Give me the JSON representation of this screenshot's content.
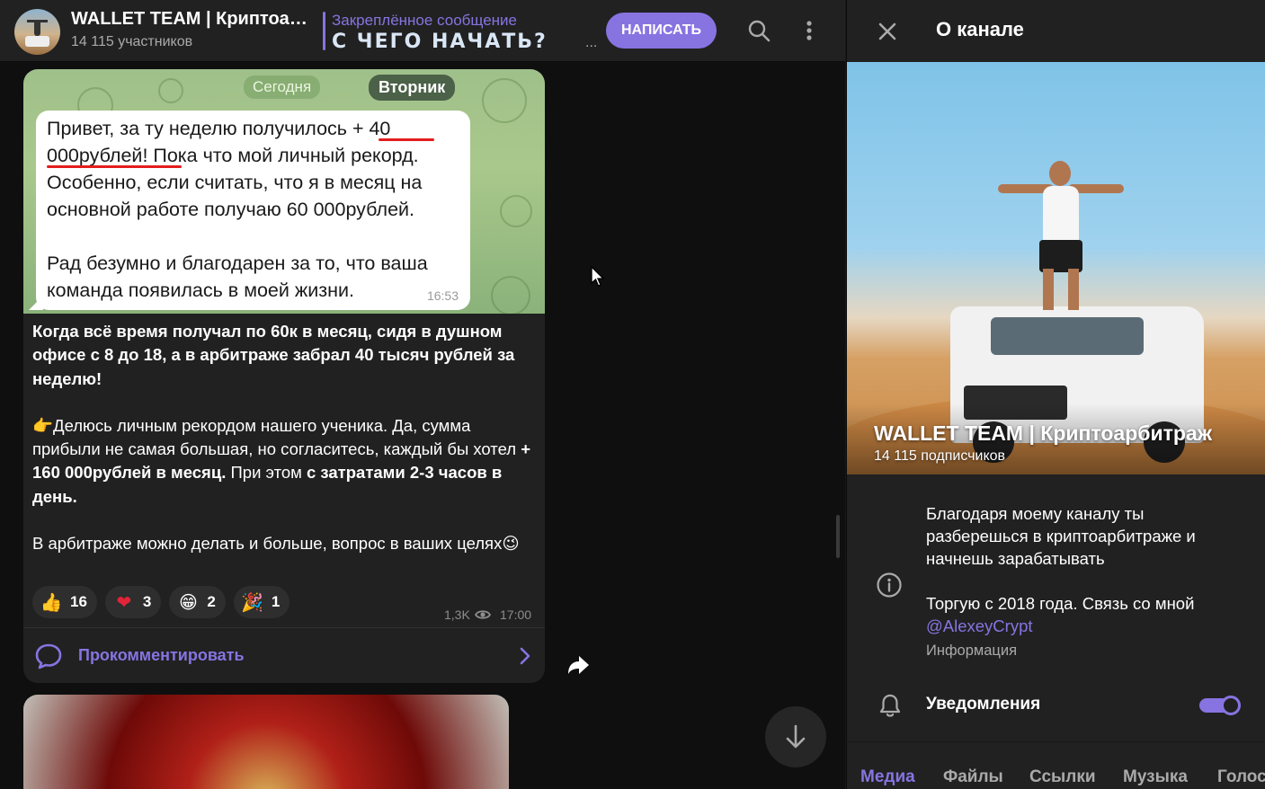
{
  "chat": {
    "title": "WALLET TEAM | Криптоарбитраж",
    "subtitle": "14 115 участников",
    "pinned_label": "Закреплённое сообщение",
    "pinned_text": "С ЧЕГО НАЧАТЬ?",
    "pinned_ellipsis": "...",
    "write_button": "НАПИСАТЬ"
  },
  "message": {
    "image": {
      "date_today": "Сегодня",
      "date_weekday": "Вторник",
      "paragraph_1": "Привет, за ту неделю получилось + 40 000рублей! Пока что мой личный рекорд. Особенно, если считать, что я в месяц на основной работе получаю 60 000рублей.",
      "paragraph_2": "Рад безумно и благодарен за то, что ваша команда появилась в моей жизни.",
      "time": "16:53"
    },
    "body": {
      "p1": "Когда всё время получал по 60к в месяц, сидя в душном офисе с 8 до 18, а в арбитраже забрал 40 тысяч рублей за неделю!",
      "p2_emoji": "👉",
      "p2_text": "Делюсь личным рекордом нашего ученика. Да, сумма прибыли не самая большая, но согласитесь, каждый бы хотел ",
      "p2_bold": "+ 160 000рублей в месяц.",
      "p2_text2": " При этом ",
      "p2_bold2": "с затратами 2-3 часов в день.",
      "p3": "В арбитраже можно делать и больше, вопрос в ваших целях",
      "p3_emoji": "😉"
    },
    "reactions": [
      {
        "emoji": "👍",
        "count": "16"
      },
      {
        "emoji": "❤",
        "count": "3"
      },
      {
        "emoji": "😁",
        "count": "2"
      },
      {
        "emoji": "🎉",
        "count": "1"
      }
    ],
    "views": "1,3K",
    "time": "17:00",
    "comment_label": "Прокомментировать"
  },
  "panel": {
    "title": "О канале",
    "channel_name": "WALLET TEAM | Криптоарбитраж",
    "subscribers": "14 115 подписчиков",
    "about_line_1": "Благодаря моему каналу ты разберешься в криптоарбитраже и начнешь зарабатывать",
    "about_line_2": "Торгую с 2018 года. Связь со мной",
    "about_link": "@AlexeyCrypt",
    "about_caption": "Информация",
    "notifications_label": "Уведомления",
    "notifications_on": true,
    "tabs": [
      "Медиа",
      "Файлы",
      "Ссылки",
      "Музыка",
      "Голос"
    ]
  },
  "colors": {
    "accent": "#8774e1",
    "background": "#0f0f0f",
    "surface": "#212121"
  },
  "icons": [
    "search-icon",
    "more-vertical-icon",
    "close-icon",
    "info-icon",
    "bell-icon",
    "comment-icon",
    "chevron-right-icon",
    "share-icon",
    "arrow-down-icon",
    "eye-icon"
  ]
}
